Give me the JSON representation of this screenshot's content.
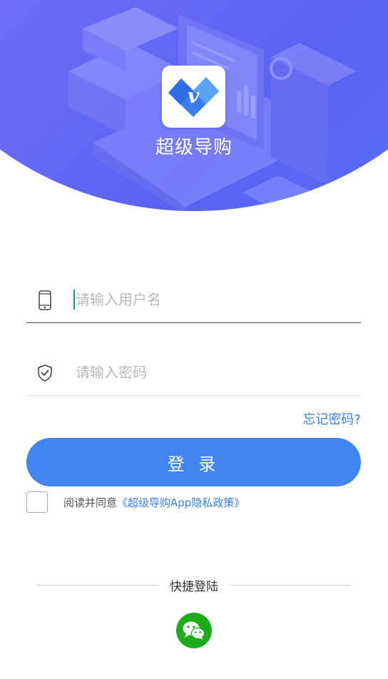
{
  "app": {
    "name": "超级导购",
    "logo_icon": "v-diamond-logo-icon"
  },
  "form": {
    "username": {
      "placeholder": "请输入用户名",
      "value": "",
      "icon": "phone-icon"
    },
    "password": {
      "placeholder": "请输入密码",
      "value": "",
      "icon": "shield-check-icon"
    },
    "forgot_label": "忘记密码?",
    "login_label": "登 录",
    "agreement": {
      "checked": false,
      "prefix": "阅读并同意",
      "link": "《超级导购App隐私政策》"
    }
  },
  "quick_login": {
    "label": "快捷登陆",
    "wechat_icon": "wechat-icon"
  },
  "colors": {
    "accent": "#4185f2",
    "link": "#3a82e8",
    "header_gradient_start": "#8a7dff",
    "header_gradient_end": "#5b70f6",
    "wechat": "#1aad19"
  }
}
